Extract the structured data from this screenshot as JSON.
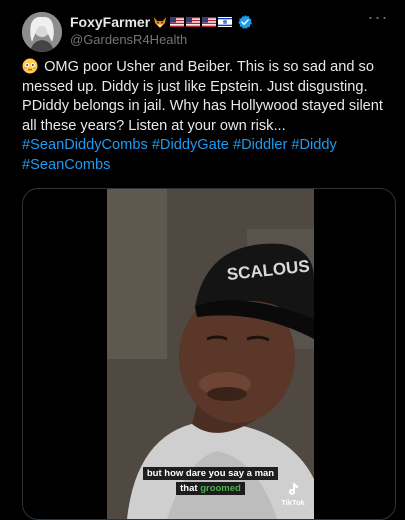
{
  "author": {
    "display_name": "FoxyFarmer",
    "handle": "@GardensR4Health",
    "flags": [
      "us-flag",
      "us-flag",
      "us-flag",
      "israel-flag"
    ],
    "emoji": "fox-icon",
    "verified": true
  },
  "more_label": "···",
  "tweet": {
    "emoji": "flushed-face-icon",
    "text": "OMG poor Usher and Beiber. This is so sad and so messed up. Diddy is just like Epstein. Just disgusting. PDiddy belongs in jail. Why has Hollywood stayed silent all these years? Listen at your own risk...",
    "hashtags": [
      "#SeanDiddyCombs",
      "#DiddyGate",
      "#Diddler",
      "#Diddy",
      "#SeanCombs"
    ]
  },
  "video": {
    "caption_line1": "but how dare you say a man",
    "caption_line2_prefix": "that ",
    "caption_line2_highlight": "groomed",
    "watermark": "TikTok",
    "hat_text": "SCALOUS"
  },
  "colors": {
    "link": "#1d9bf0",
    "verified": "#1d9bf0",
    "caption_highlight": "#4caf50"
  }
}
